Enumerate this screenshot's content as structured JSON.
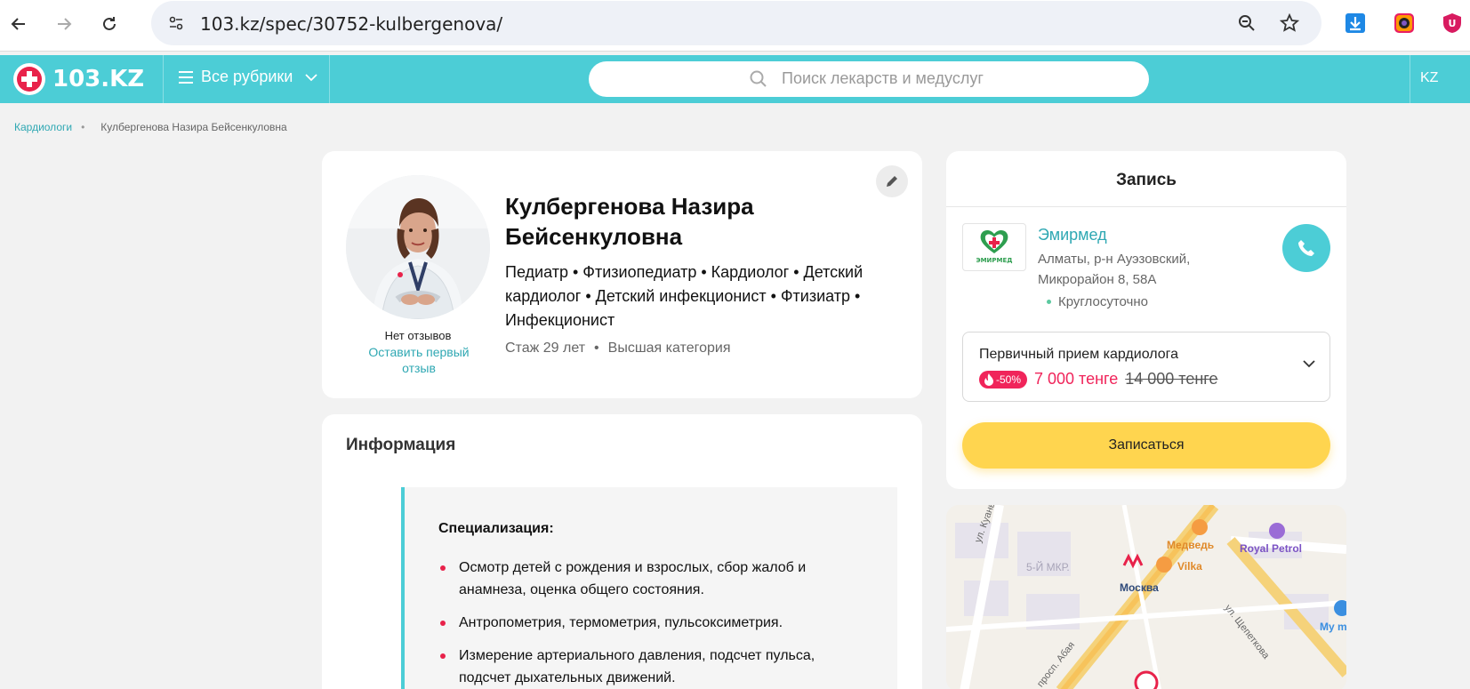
{
  "browser": {
    "url": "103.kz/spec/30752-kulbergenova/"
  },
  "header": {
    "logo_text": "103.KZ",
    "rubrics_label": "Все рубрики",
    "search_placeholder": "Поиск лекарств и медуслуг",
    "lang": "KZ"
  },
  "breadcrumb": {
    "link": "Кардиологи",
    "separator": "•",
    "current": "Кулбергенова Назира Бейсенкуловна"
  },
  "profile": {
    "name": "Кулбергенова Назира Бейсенкуловна",
    "specialties": "Педиатр • Фтизиопедиатр • Кардиолог • Детский кардиолог • Детский инфекционист • Фтизиатр • Инфекционист",
    "experience": "Стаж 29 лет",
    "meta_sep": "•",
    "category": "Высшая категория",
    "no_reviews": "Нет отзывов",
    "leave_review": "Оставить первый отзыв"
  },
  "info": {
    "title": "Информация",
    "spec_title": "Специализация:",
    "items": [
      "Осмотр детей с рождения и взрослых, сбор жалоб и анамнеза, оценка общего состояния.",
      "Антропометрия, термометрия, пульсоксиметрия.",
      "Измерение артериального давления, подсчет пульса, подсчет дыхательных движений."
    ]
  },
  "booking": {
    "title": "Запись",
    "clinic_name": "Эмирмед",
    "clinic_logo_text": "ЭМИРМЕД",
    "clinic_address": "Алматы, р-н Ауэзовский, Микрорайон 8, 58А",
    "clinic_hours": "Круглосуточно",
    "service_name": "Первичный прием кардиолога",
    "discount": "-50%",
    "price_new": "7 000 тенге",
    "price_old": "14 000 тенге",
    "book_label": "Записаться"
  },
  "map": {
    "labels": {
      "medved": "Медведь",
      "royal": "Royal Petrol",
      "vilka": "Vilka",
      "moskva": "Москва",
      "district": "5-Й МКР.",
      "street_kuanysh": "ул. Куанышбаева",
      "street_shchep": "ул. Щепеткова",
      "street_abaya": "просп. Абая",
      "mym": "My m"
    }
  },
  "colors": {
    "brand": "#4ccdd6",
    "link": "#2fa8b3",
    "accent_red": "#f0245a",
    "book_button": "#ffd54f"
  }
}
